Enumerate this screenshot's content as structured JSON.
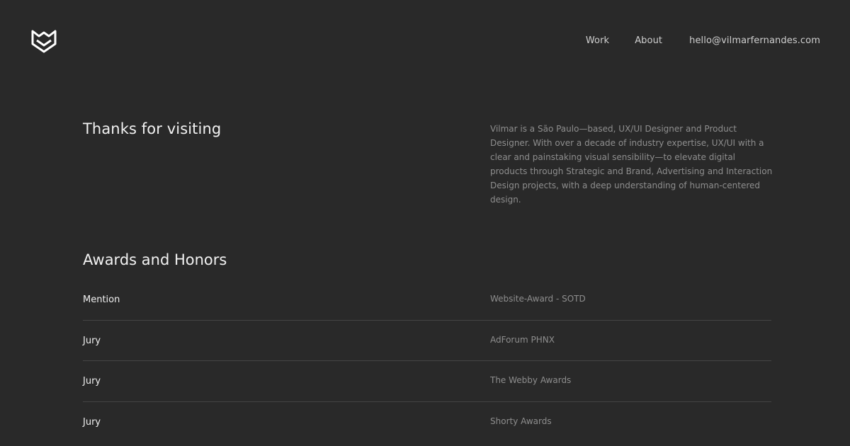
{
  "header": {
    "logo_icon": "vf-chevron-shield-logo-icon",
    "nav": {
      "work": "Work",
      "about": "About",
      "email": "hello@vilmarfernandes.com"
    }
  },
  "intro": {
    "title": "Thanks for visiting",
    "description": "Vilmar is a São Paulo—based, UX/UI Designer and Product Designer. With over a decade of industry expertise, UX/UI with a clear and painstaking visual sensibility—to elevate digital products through Strategic and Brand, Advertising and Interaction Design projects, with a deep understanding of human-centered design."
  },
  "awards": {
    "title": "Awards and Honors",
    "items": [
      {
        "type": "Mention",
        "name": "Website-Award - SOTD"
      },
      {
        "type": "Jury",
        "name": "AdForum PHNX"
      },
      {
        "type": "Jury",
        "name": "The Webby Awards"
      },
      {
        "type": "Jury",
        "name": "Shorty Awards"
      }
    ]
  },
  "colors": {
    "background": "#292929",
    "heading": "#f2f2f2",
    "muted_text": "#8e8e8e",
    "divider": "#444444"
  }
}
